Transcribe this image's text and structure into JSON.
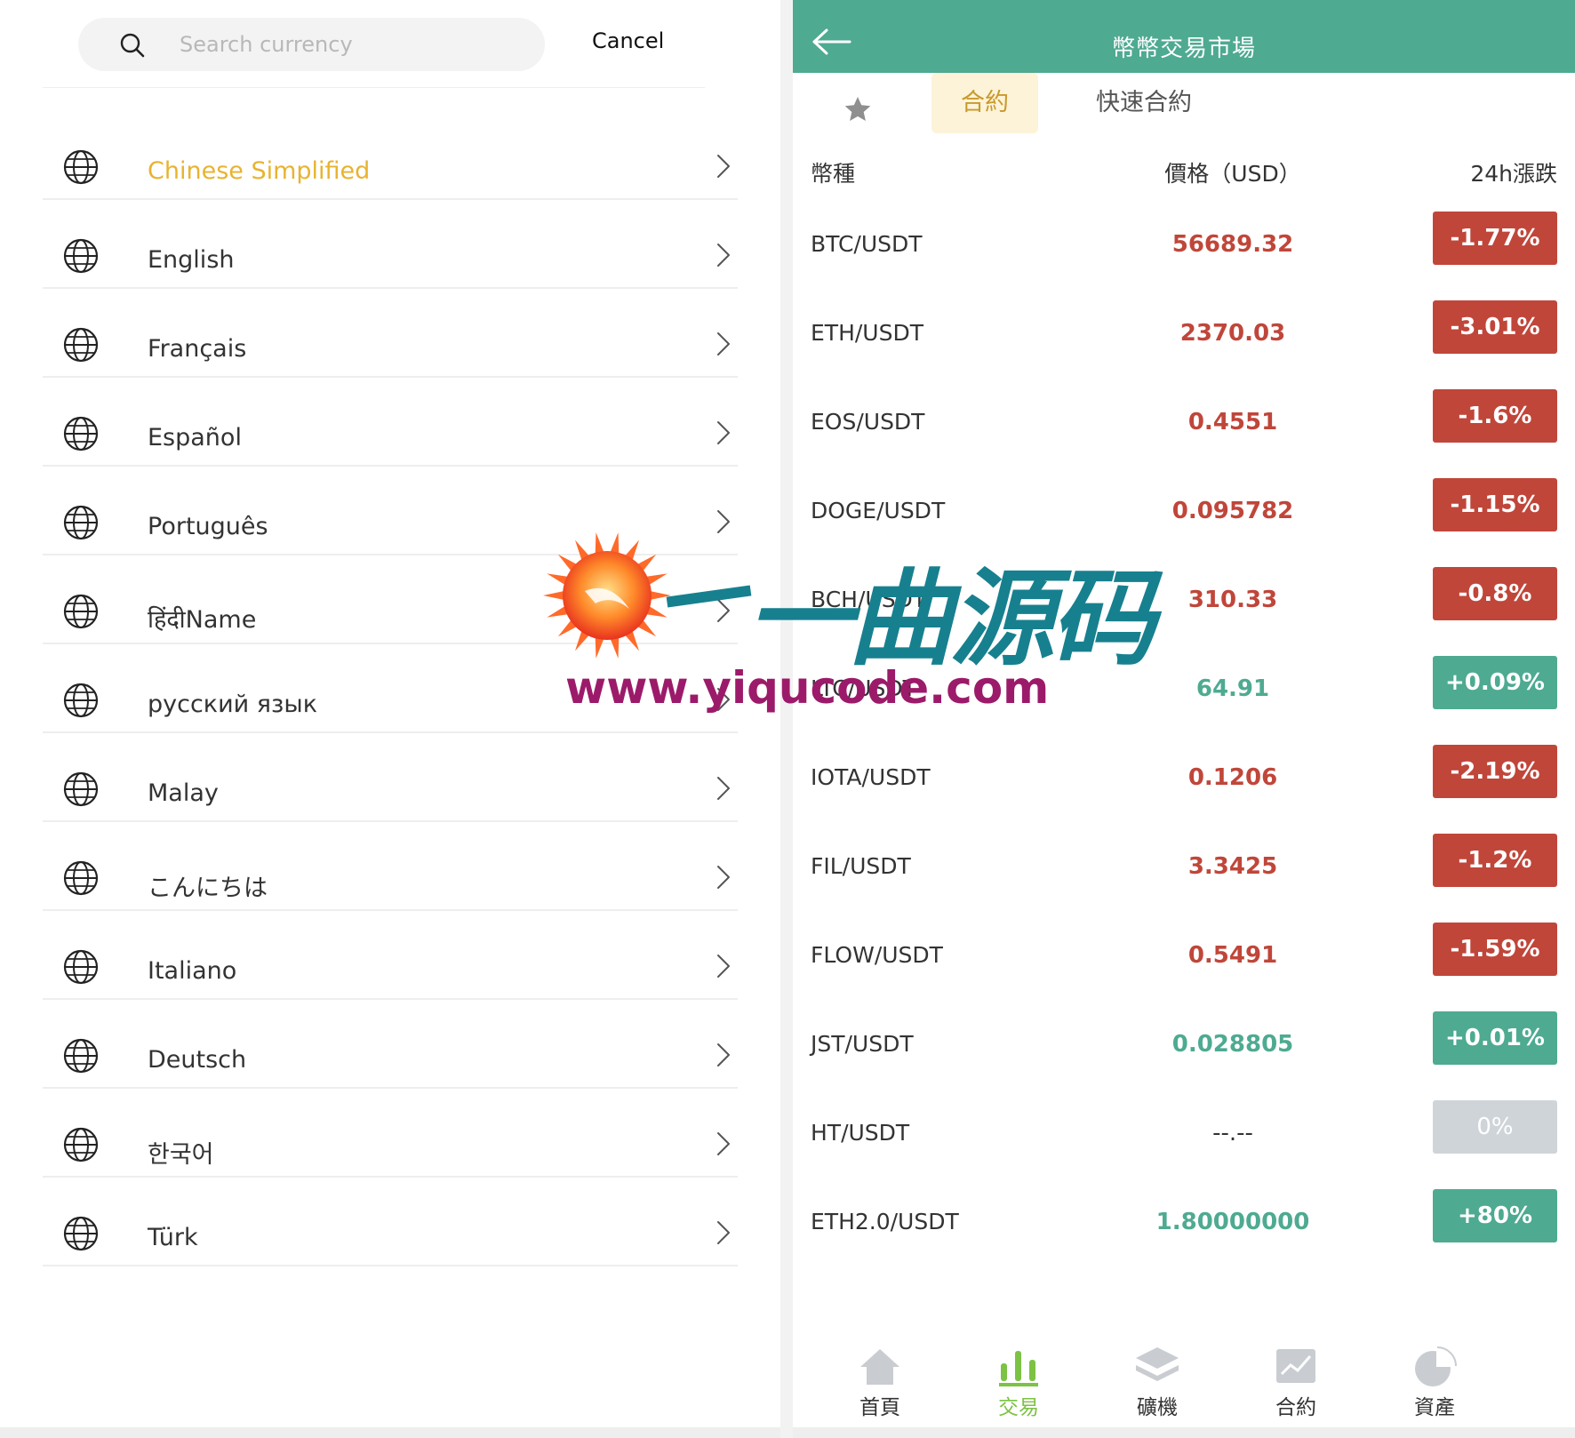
{
  "left": {
    "search": {
      "placeholder": "Search currency"
    },
    "cancel_label": "Cancel",
    "languages": [
      {
        "label": "Chinese Simplified",
        "active": true
      },
      {
        "label": "English",
        "active": false
      },
      {
        "label": "Français",
        "active": false
      },
      {
        "label": "Español",
        "active": false
      },
      {
        "label": "Português",
        "active": false
      },
      {
        "label": "हिंदीName",
        "active": false
      },
      {
        "label": "русский язык",
        "active": false
      },
      {
        "label": "Malay",
        "active": false
      },
      {
        "label": "こんにちは",
        "active": false
      },
      {
        "label": "Italiano",
        "active": false
      },
      {
        "label": "Deutsch",
        "active": false
      },
      {
        "label": "한국어",
        "active": false
      },
      {
        "label": "Türk",
        "active": false
      }
    ],
    "colors": {
      "active_label": "#e8b330"
    }
  },
  "right": {
    "header": {
      "title": "幣幣交易市場"
    },
    "tabs": {
      "favorites_icon": "star-icon",
      "contract": "合約",
      "quick_contract": "快速合約"
    },
    "columns": {
      "coin": "幣種",
      "price": "價格（USD）",
      "change": "24h漲跌"
    },
    "rows": [
      {
        "pair": "BTC/USDT",
        "price": "56689.32",
        "change": "-1.77%",
        "trend": "down"
      },
      {
        "pair": "ETH/USDT",
        "price": "2370.03",
        "change": "-3.01%",
        "trend": "down"
      },
      {
        "pair": "EOS/USDT",
        "price": "0.4551",
        "change": "-1.6%",
        "trend": "down"
      },
      {
        "pair": "DOGE/USDT",
        "price": "0.095782",
        "change": "-1.15%",
        "trend": "down"
      },
      {
        "pair": "BCH/USDT",
        "price": "310.33",
        "change": "-0.8%",
        "trend": "down"
      },
      {
        "pair": "LTC/USDT",
        "price": "64.91",
        "change": "+0.09%",
        "trend": "up"
      },
      {
        "pair": "IOTA/USDT",
        "price": "0.1206",
        "change": "-2.19%",
        "trend": "down"
      },
      {
        "pair": "FIL/USDT",
        "price": "3.3425",
        "change": "-1.2%",
        "trend": "down"
      },
      {
        "pair": "FLOW/USDT",
        "price": "0.5491",
        "change": "-1.59%",
        "trend": "down"
      },
      {
        "pair": "JST/USDT",
        "price": "0.028805",
        "change": "+0.01%",
        "trend": "up"
      },
      {
        "pair": "HT/USDT",
        "price": "--.--",
        "change": "0%",
        "trend": "flat"
      },
      {
        "pair": "ETH2.0/USDT",
        "price": "1.80000000",
        "change": "+80%",
        "trend": "up"
      }
    ],
    "bottom_nav": [
      {
        "label": "首頁",
        "icon": "home-icon",
        "active": false
      },
      {
        "label": "交易",
        "icon": "bar-chart-icon",
        "active": true
      },
      {
        "label": "礦機",
        "icon": "layers-icon",
        "active": false
      },
      {
        "label": "合約",
        "icon": "trend-chart-icon",
        "active": false
      },
      {
        "label": "資產",
        "icon": "pie-chart-icon",
        "active": false
      }
    ],
    "colors": {
      "header": "#4eaa91",
      "down": "#c0463a",
      "up": "#4eaa91",
      "flat_badge": "#cfd4d9",
      "flat_price": "#333333",
      "active_tab_bg": "#fcf3d8",
      "active_tab_text": "#c99a2c",
      "active_nav": "#7cc244"
    }
  },
  "watermark": {
    "text_cn": "一曲源码",
    "url": "www.yiqucode.com"
  }
}
